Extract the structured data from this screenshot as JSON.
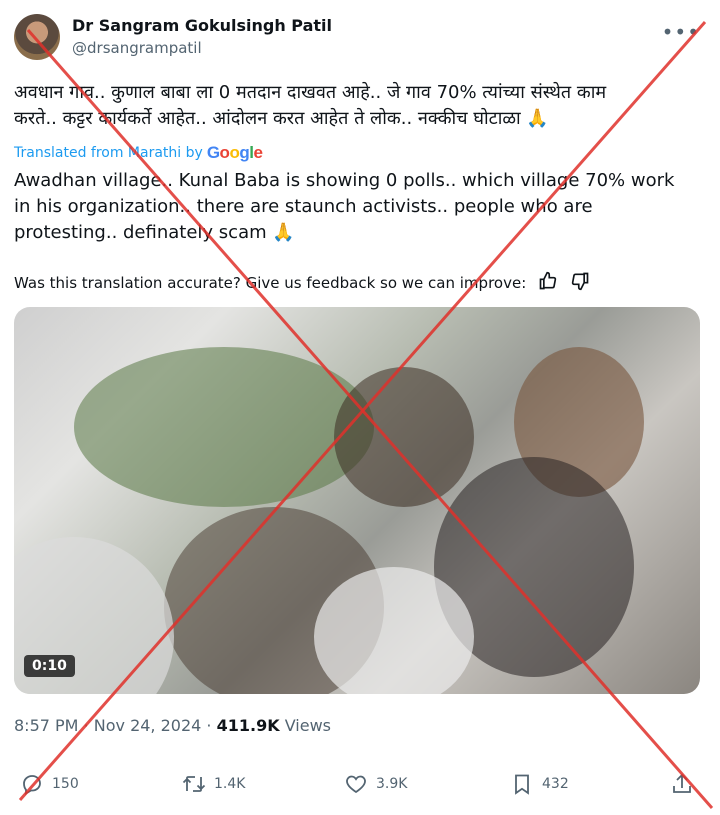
{
  "author": {
    "display_name": "Dr Sangram Gokulsingh Patil",
    "handle": "@drsangrampatil"
  },
  "tweet": {
    "text_line1": "अवधान गाव.. कुणाल बाबा ला 0 मतदान दाखवत आहे.. जे गाव 70% त्यांच्या संस्थेत काम",
    "text_line2": "करते.. कट्टर कार्यकर्ते आहेत.. आंदोलन करत आहेत ते लोक.. नक्कीच घोटाळा 🙏",
    "translated_from": "Translated from Marathi by",
    "translator": "Google",
    "translation_line1": "Awadhan village.. Kunal Baba is showing 0 polls.. which village 70% work",
    "translation_line2": "in his organization.. there are staunch activists.. people who are",
    "translation_line3": "protesting.. definately scam 🙏",
    "feedback_prompt": "Was this translation accurate? Give us feedback so we can improve:"
  },
  "media": {
    "duration": "0:10"
  },
  "meta": {
    "time": "8:57 PM",
    "date": "Nov 24, 2024",
    "views_count": "411.9K",
    "views_label": "Views",
    "separator": "·"
  },
  "actions": {
    "replies": "150",
    "retweets": "1.4K",
    "likes": "3.9K",
    "bookmarks": "432"
  },
  "icons": [
    "more-icon",
    "thumbs-up-icon",
    "thumbs-down-icon",
    "reply-icon",
    "retweet-icon",
    "like-icon",
    "bookmark-icon",
    "share-icon"
  ],
  "colors": {
    "link": "#1d9bf0",
    "secondary_text": "#536471",
    "cross_overlay": "#e0312b"
  }
}
